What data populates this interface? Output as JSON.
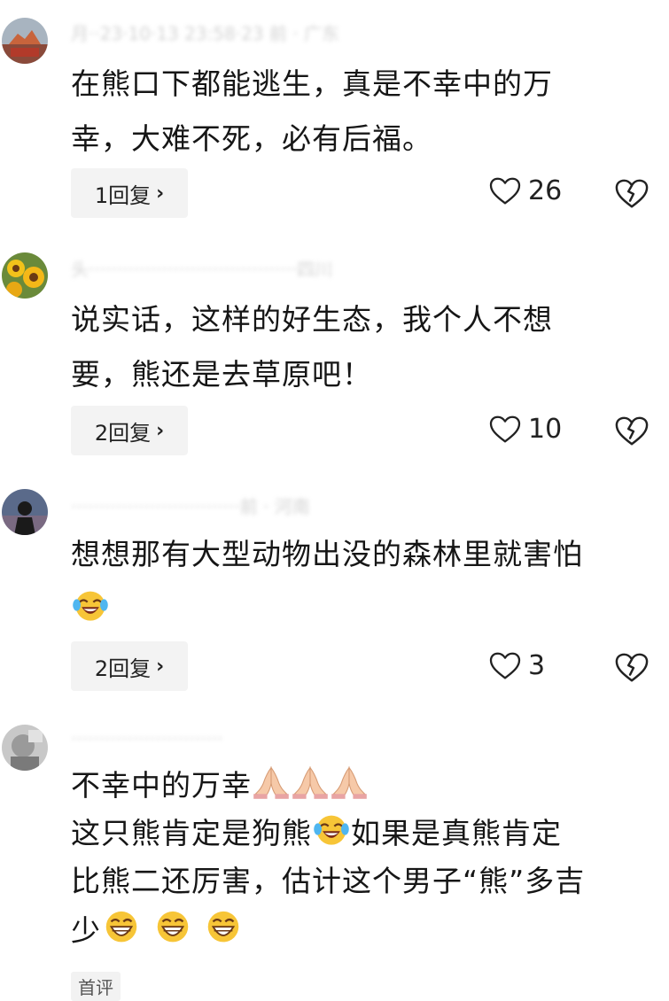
{
  "comments": [
    {
      "meta": "月··23·10·13 23:58·23 前 · 广东",
      "lines": [
        "在熊口下都能逃生，真是不幸中的万",
        "幸，大难不死，必有后福。"
      ],
      "reply_label": "1回复",
      "likes": "26"
    },
    {
      "meta": "头·····································四川",
      "lines": [
        "说实话，这样的好生态，我个人不想",
        "要，熊还是去草原吧！"
      ],
      "reply_label": "2回复",
      "likes": "10"
    },
    {
      "meta": "······························前 · 河南",
      "lines": [
        "想想那有大型动物出没的森林里就害怕"
      ],
      "reply_label": "2回复",
      "likes": "3"
    },
    {
      "meta": "···························",
      "line1": "不幸中的万幸",
      "line2a": "这只熊肯定是狗熊",
      "line2b": "如果是真熊肯定",
      "line3": "比熊二还厉害，估计这个男子“熊”多吉",
      "line4": "少"
    }
  ],
  "first_tag": "首评",
  "icons": {
    "like": "heart-outline-icon",
    "dislike": "broken-heart-icon",
    "chevron": "chevron-right-icon",
    "emoji_laugh": "laughing-crying-emoji",
    "emoji_pray": "praying-hands-emoji",
    "emoji_grin": "grinning-emoji"
  },
  "colors": {
    "reply_bg": "#f3f3f3",
    "meta": "#c4c4c4",
    "text": "#161616"
  }
}
